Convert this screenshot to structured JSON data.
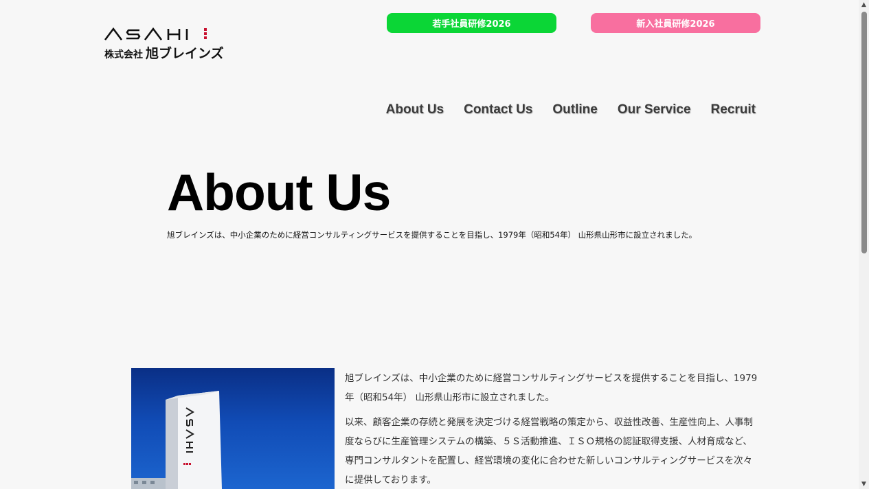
{
  "logo": {
    "wordmark": "ASAHI",
    "company_prefix": "株式会社",
    "company_name": "旭ブレインズ"
  },
  "buttons": {
    "young_training": "若手社員研修2026",
    "new_training": "新入社員研修2026"
  },
  "nav": {
    "items": [
      "About Us",
      "Contact Us",
      "Outline",
      "Our Service",
      "Recruit"
    ]
  },
  "hero": {
    "title": "About Us",
    "lead": "旭ブレインズは、中小企業のために経営コンサルティングサービスを提供することを目指し、1979年（昭和54年） 山形県山形市に設立されました。"
  },
  "content": {
    "paragraph1": "旭ブレインズは、中小企業のために経営コンサルティングサービスを提供することを目指し、1979年（昭和54年） 山形県山形市に設立されました。",
    "paragraph2": "以来、顧客企業の存続と発展を決定づける経営戦略の策定から、収益性改善、生産性向上、人事制度ならびに生産管理システムの構築、５Ｓ活動推進、ＩＳＯ規格の認証取得支援、人材育成など、専門コンサルタントを配置し、経営環境の変化に合わせた新しいコンサルティングサービスを次々に提供しております。"
  },
  "photo": {
    "sign_text": "ASAHI"
  },
  "colors": {
    "young_button": "#0bd636",
    "new_button": "#f86f9f",
    "logo_accent": "#c8102e"
  }
}
